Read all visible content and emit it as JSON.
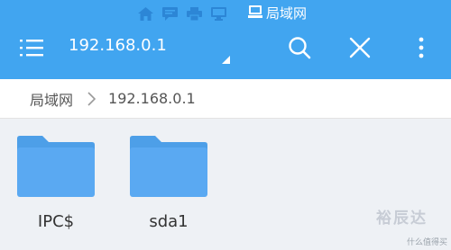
{
  "colors": {
    "appbar": "#41a5f0",
    "content_bg": "#eef1f5",
    "folder": "#5aa9f2"
  },
  "statusbar": {
    "icons": [
      "home-icon",
      "message-icon",
      "printer-icon",
      "monitor-icon",
      "computer-icon"
    ],
    "title": "局域网"
  },
  "toolbar": {
    "path": "192.168.0.1",
    "icons": [
      "menu-icon",
      "search-icon",
      "close-icon",
      "more-vert-icon"
    ]
  },
  "breadcrumb": {
    "root": "局域网",
    "current": "192.168.0.1"
  },
  "items": [
    {
      "label": "IPC$",
      "icon": "folder-icon"
    },
    {
      "label": "sda1",
      "icon": "folder-icon"
    }
  ],
  "watermark": {
    "text": "裕辰达",
    "subtext": "什么值得买"
  }
}
